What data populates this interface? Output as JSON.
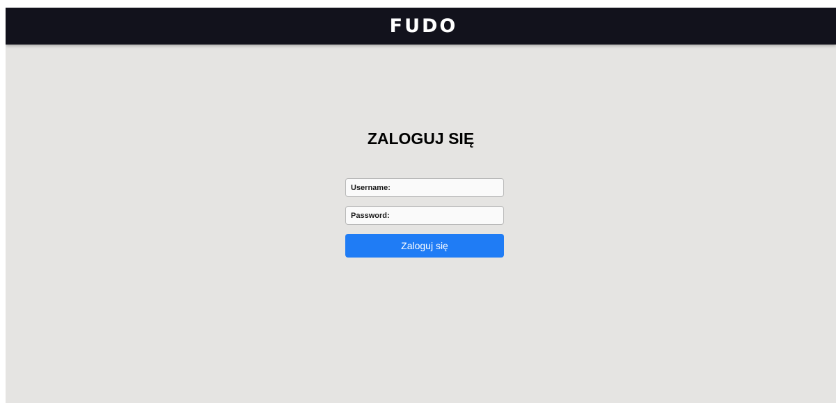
{
  "header": {
    "logo_text": "FUDO",
    "background": "#12121c"
  },
  "login": {
    "title": "ZALOGUJ SIĘ",
    "username_placeholder": "Username:",
    "password_placeholder": "Password:",
    "submit_label": "Zaloguj się",
    "submit_color": "#1f7cf5"
  },
  "page": {
    "background": "#e5e4e2"
  }
}
